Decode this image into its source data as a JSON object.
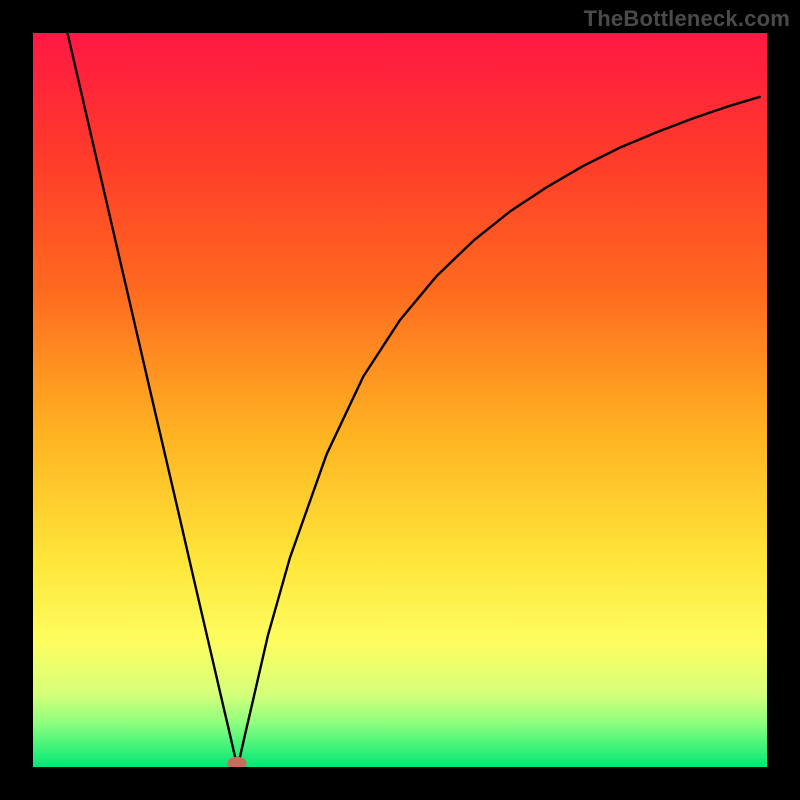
{
  "watermark": "TheBottleneck.com",
  "colors": {
    "frame": "#000000",
    "gradient_stops": [
      {
        "offset": 0.0,
        "color": "#ff1844"
      },
      {
        "offset": 0.17,
        "color": "#ff3b2a"
      },
      {
        "offset": 0.35,
        "color": "#ff6a1f"
      },
      {
        "offset": 0.55,
        "color": "#ffb422"
      },
      {
        "offset": 0.72,
        "color": "#ffe63a"
      },
      {
        "offset": 0.83,
        "color": "#fdfd60"
      },
      {
        "offset": 0.9,
        "color": "#d6ff7a"
      },
      {
        "offset": 0.94,
        "color": "#8eff7f"
      },
      {
        "offset": 1.0,
        "color": "#00e876"
      }
    ],
    "curve": "#000000",
    "marker": "#c96b5a"
  },
  "chart_data": {
    "type": "line",
    "title": "",
    "xlabel": "",
    "ylabel": "",
    "xlim": [
      0,
      100
    ],
    "ylim": [
      0,
      100
    ],
    "grid": false,
    "legend": false,
    "annotations": [],
    "x": [
      4.7,
      8,
      12,
      16,
      20,
      22,
      24,
      25,
      25.9,
      26.7,
      27.5,
      28,
      29,
      30,
      32,
      35,
      40,
      45,
      50,
      55,
      60,
      65,
      70,
      75,
      80,
      85,
      90,
      95,
      99
    ],
    "values": [
      100,
      85.7,
      68.4,
      51.1,
      33.9,
      25.2,
      16.6,
      12.3,
      8.4,
      5.0,
      1.5,
      0.5,
      4.9,
      9.2,
      17.9,
      28.5,
      42.6,
      53.2,
      60.9,
      66.9,
      71.7,
      75.7,
      79.0,
      81.9,
      84.4,
      86.5,
      88.4,
      90.1,
      91.3
    ],
    "series": [
      {
        "name": "curve",
        "x_ref": "x",
        "y_ref": "values"
      }
    ],
    "marker": {
      "x": 27.8,
      "y": 0.5,
      "rx": 1.3,
      "ry": 0.9
    }
  }
}
